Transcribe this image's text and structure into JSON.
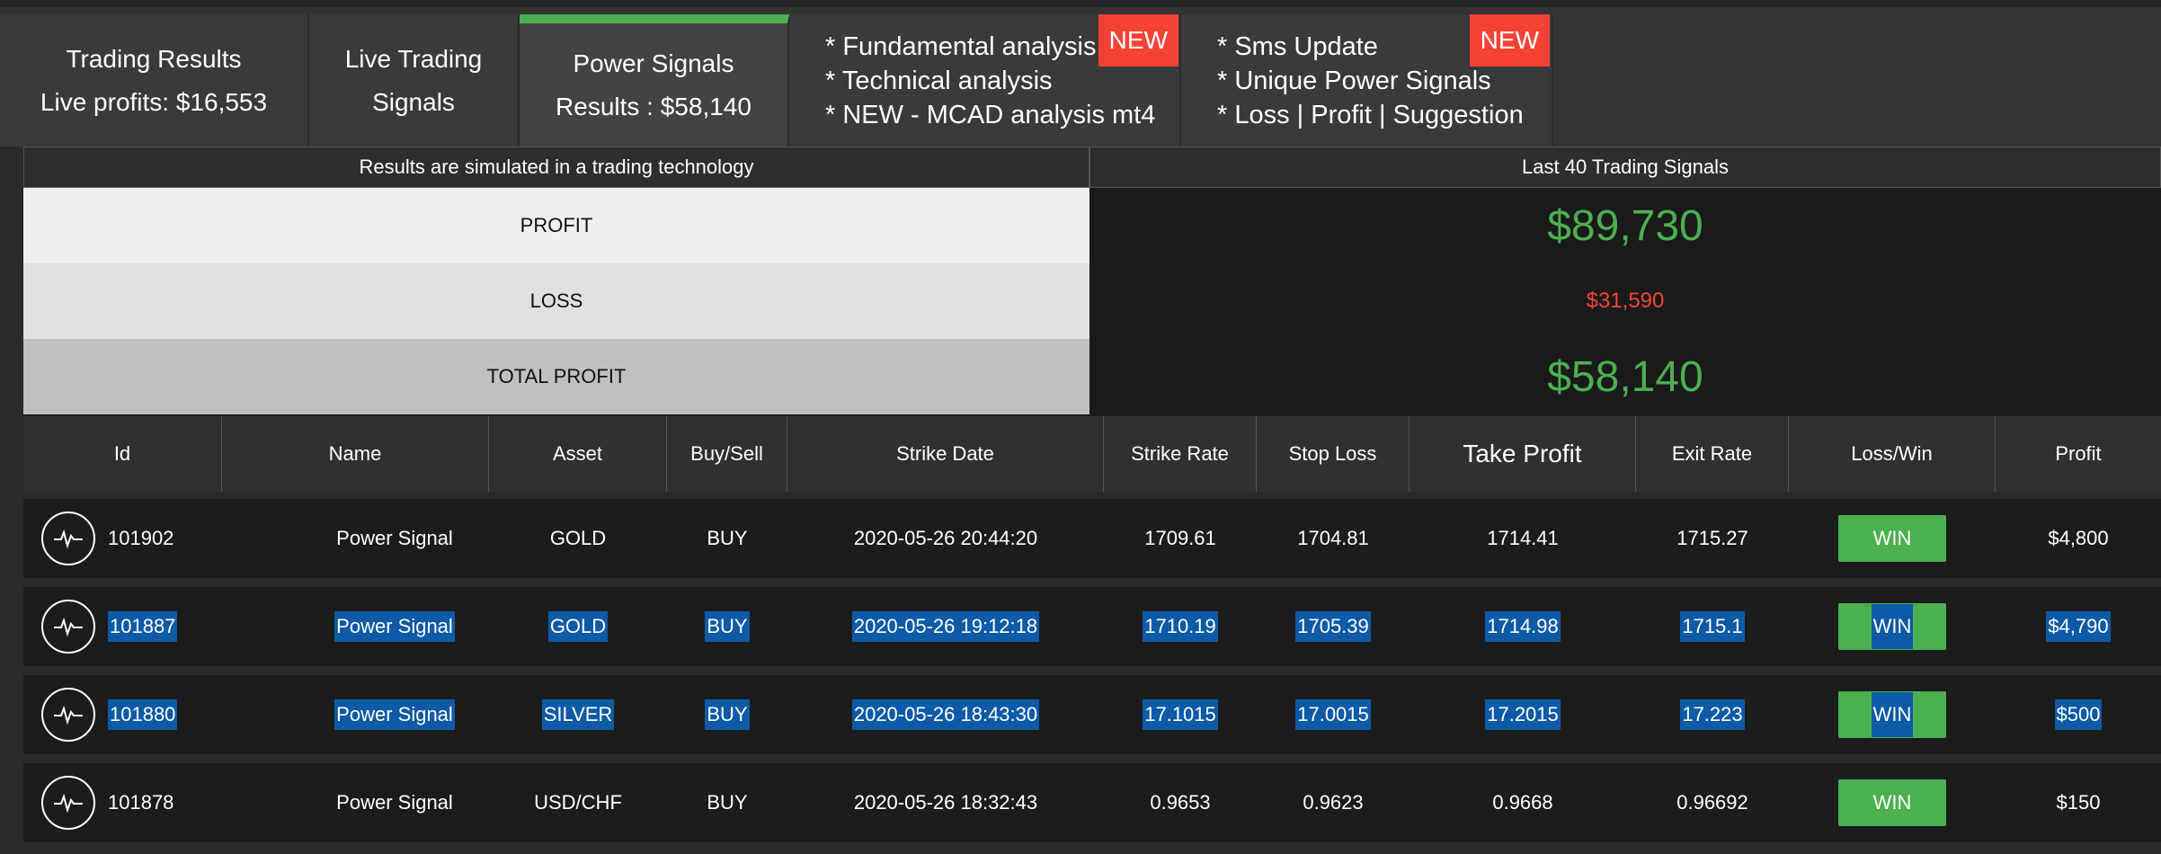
{
  "tabs": [
    {
      "line1": "Trading Results",
      "line2": "Live profits: $16,553"
    },
    {
      "line1": "Live Trading",
      "line2": "Signals"
    },
    {
      "line1": "Power Signals",
      "line2": "Results : $58,140"
    }
  ],
  "info_tabs": [
    {
      "lines": [
        "* Fundamental analysis",
        "* Technical analysis",
        "* NEW - MCAD analysis mt4"
      ],
      "badge": "NEW"
    },
    {
      "lines": [
        "* Sms Update",
        "* Unique Power Signals",
        "* Loss | Profit | Suggestion"
      ],
      "badge": "NEW"
    }
  ],
  "summary": {
    "left_header": "Results are simulated in a trading technology",
    "right_header": "Last 40 Trading Signals",
    "profit_label": "PROFIT",
    "profit_value": "$89,730",
    "loss_label": "LOSS",
    "loss_value": "$31,590",
    "total_label": "TOTAL PROFIT",
    "total_value": "$58,140"
  },
  "table": {
    "headers": [
      "Id",
      "Name",
      "Asset",
      "Buy/Sell",
      "Strike Date",
      "Strike Rate",
      "Stop Loss",
      "Take Profit",
      "Exit Rate",
      "Loss/Win",
      "Profit"
    ],
    "rows": [
      {
        "id": "101902",
        "name": "Power Signal",
        "asset": "GOLD",
        "side": "BUY",
        "date": "2020-05-26 20:44:20",
        "strike": "1709.61",
        "stop": "1704.81",
        "take": "1714.41",
        "exit": "1715.27",
        "result": "WIN",
        "profit": "$4,800"
      },
      {
        "id": "101887",
        "name": "Power Signal",
        "asset": "GOLD",
        "side": "BUY",
        "date": "2020-05-26 19:12:18",
        "strike": "1710.19",
        "stop": "1705.39",
        "take": "1714.98",
        "exit": "1715.1",
        "result": "WIN",
        "profit": "$4,790"
      },
      {
        "id": "101880",
        "name": "Power Signal",
        "asset": "SILVER",
        "side": "BUY",
        "date": "2020-05-26 18:43:30",
        "strike": "17.1015",
        "stop": "17.0015",
        "take": "17.2015",
        "exit": "17.223",
        "result": "WIN",
        "profit": "$500"
      },
      {
        "id": "101878",
        "name": "Power Signal",
        "asset": "USD/CHF",
        "side": "BUY",
        "date": "2020-05-26 18:32:43",
        "strike": "0.9653",
        "stop": "0.9623",
        "take": "0.9668",
        "exit": "0.96692",
        "result": "WIN",
        "profit": "$150"
      }
    ]
  },
  "colors": {
    "accent": "#4caf50",
    "loss": "#f44336",
    "selection": "#0d5aa7"
  },
  "icons": {
    "row_icon": "pulse-icon"
  }
}
